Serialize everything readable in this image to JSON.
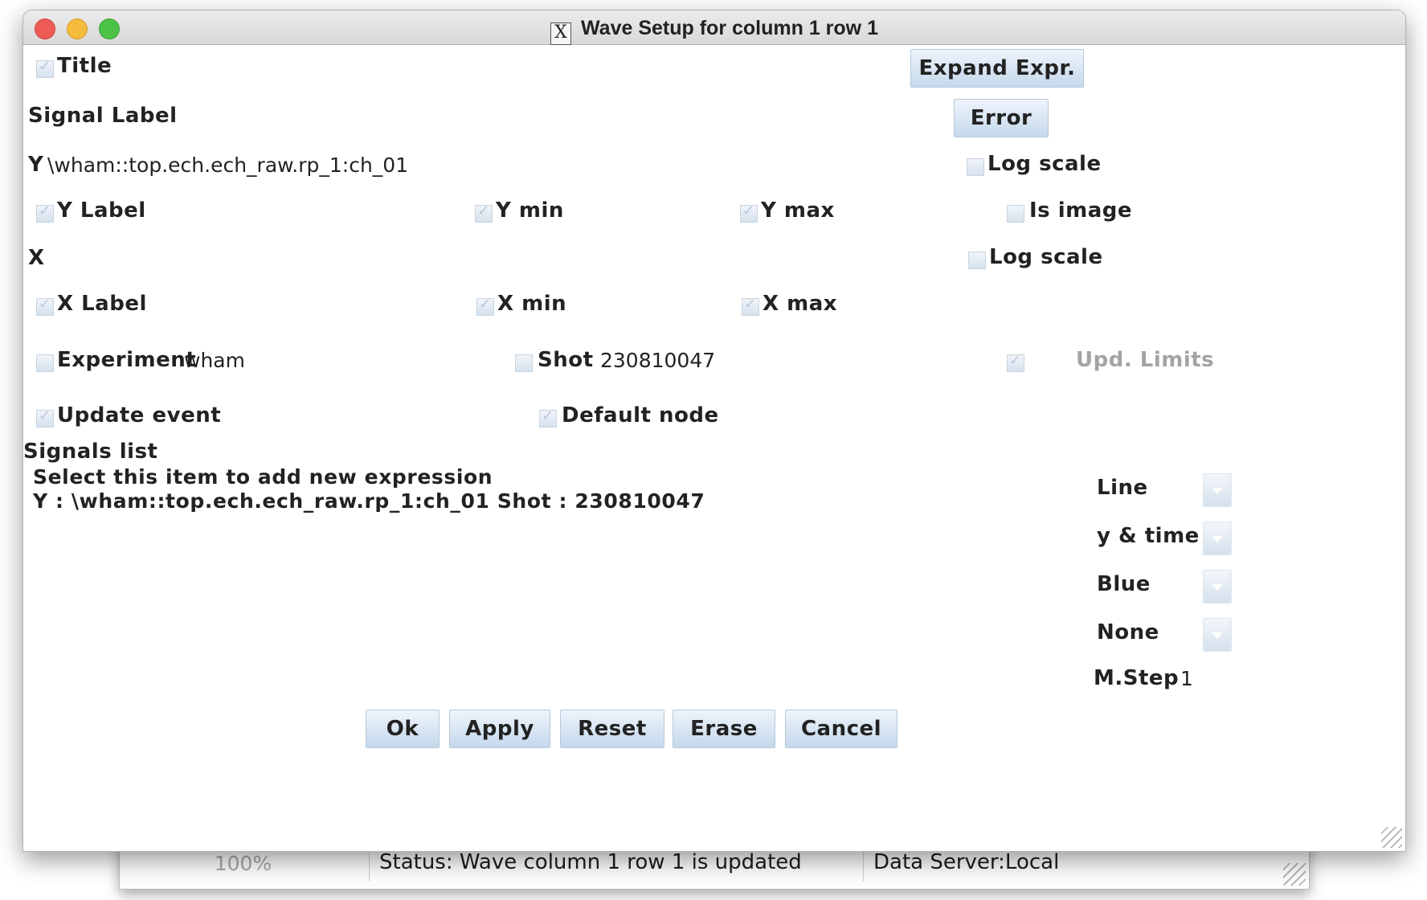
{
  "window": {
    "title": "Wave Setup for column 1 row 1",
    "x11_icon": "X"
  },
  "fields": {
    "title_label": "Title",
    "signal_label": "Signal Label",
    "y_prefix": "Y",
    "y_expression": "\\wham::top.ech.ech_raw.rp_1:ch_01",
    "y_label": "Y Label",
    "y_min": "Y min",
    "y_max": "Y max",
    "is_image": "Is image",
    "log_scale_y": "Log scale",
    "x_prefix": "X",
    "log_scale_x": "Log scale",
    "x_label": "X Label",
    "x_min": "X min",
    "x_max": "X max",
    "experiment_label": "Experiment",
    "experiment_value": "wham",
    "shot_label": "Shot",
    "shot_value": "230810047",
    "upd_limits": "Upd. Limits",
    "update_event": "Update event",
    "default_node": "Default node"
  },
  "buttons": {
    "expand_expr": "Expand Expr.",
    "error": "Error",
    "ok": "Ok",
    "apply": "Apply",
    "reset": "Reset",
    "erase": "Erase",
    "cancel": "Cancel"
  },
  "signals": {
    "header": "Signals list",
    "items": [
      "Select this item to add new expression",
      "Y : \\wham::top.ech.ech_raw.rp_1:ch_01 Shot : 230810047"
    ]
  },
  "style_options": {
    "line_mode": "Line",
    "interpolation": "y & time",
    "color": "Blue",
    "marker": "None",
    "mstep_label": "M.Step",
    "mstep_value": "1"
  },
  "status_bar": {
    "progress_text": "100%",
    "progress_value": 100,
    "status": "Status: Wave column 1 row 1 is updated",
    "server": "Data Server:Local"
  },
  "colors": {
    "button_top": "#eef4fb",
    "button_bottom": "#c5d8ec",
    "close": "#ee5b56",
    "minimize": "#f5bb3d",
    "maximize": "#4cc246"
  }
}
